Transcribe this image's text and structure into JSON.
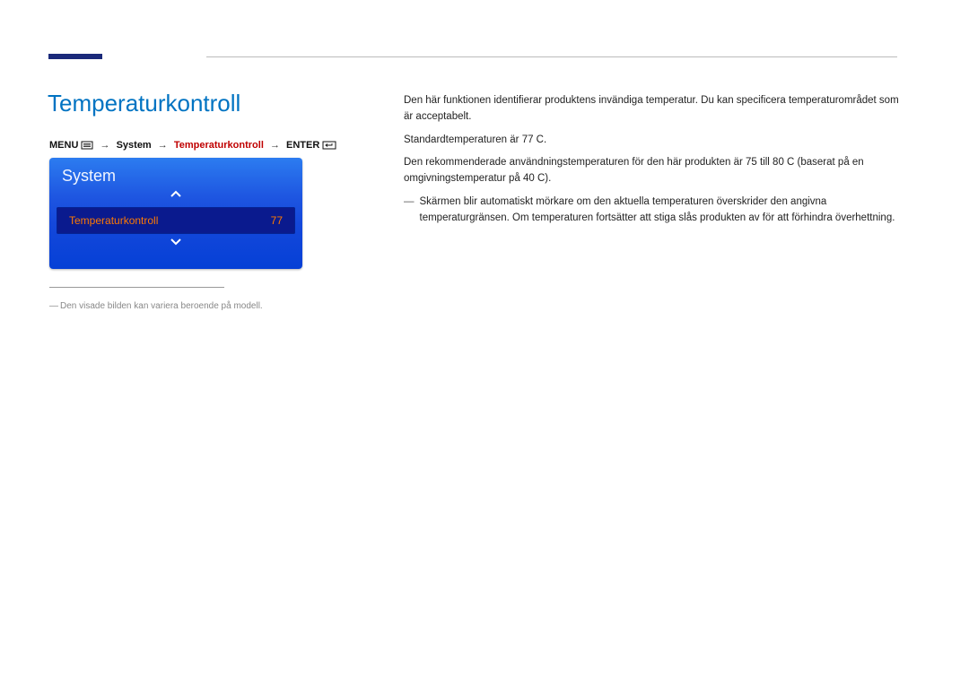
{
  "page": {
    "title": "Temperaturkontroll"
  },
  "breadcrumb": {
    "menu": "MENU",
    "system": "System",
    "item": "Temperaturkontroll",
    "enter": "ENTER"
  },
  "osd": {
    "header": "System",
    "row_label": "Temperaturkontroll",
    "row_value": "77"
  },
  "footnote": {
    "text": "Den visade bilden kan variera beroende på modell."
  },
  "body": {
    "p1": "Den här funktionen identifierar produktens invändiga temperatur. Du kan specificera temperaturområdet som är acceptabelt.",
    "p2": "Standardtemperaturen är 77 C.",
    "p3": "Den rekommenderade användningstemperaturen för den här produkten är 75 till 80 C (baserat på en omgivningstemperatur på 40 C).",
    "note": "Skärmen blir automatiskt mörkare om den aktuella temperaturen överskrider den angivna temperaturgränsen. Om temperaturen fortsätter att stiga slås produkten av för att förhindra överhettning."
  }
}
